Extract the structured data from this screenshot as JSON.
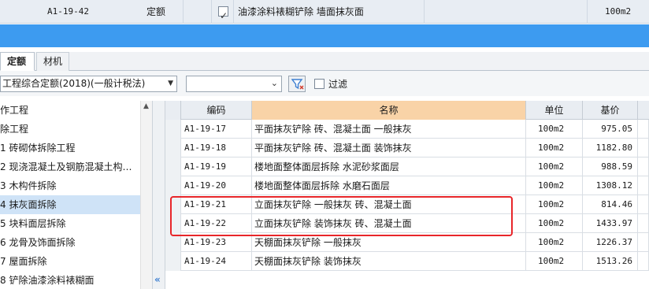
{
  "top_row": {
    "code": "A1-19-42",
    "type": "定额",
    "checked": true,
    "name": "油漆涂料裱糊铲除 墙面抹灰面",
    "unit": "100m2"
  },
  "tabs": [
    {
      "label": "定额",
      "active": true
    },
    {
      "label": "材机",
      "active": false
    }
  ],
  "toolbar": {
    "quota_select": "工程综合定额(2018)(一般计税法)",
    "search_select": "",
    "filter_label": "过滤"
  },
  "tree": {
    "items": [
      {
        "label": "作工程",
        "selected": false
      },
      {
        "label": "除工程",
        "selected": false
      },
      {
        "label": "1 砖砌体拆除工程",
        "selected": false
      },
      {
        "label": "2 现浇混凝土及钢筋混凝土构…",
        "selected": false
      },
      {
        "label": "3 木构件拆除",
        "selected": false
      },
      {
        "label": "4 抹灰面拆除",
        "selected": true
      },
      {
        "label": "5 块料面层拆除",
        "selected": false
      },
      {
        "label": "6 龙骨及饰面拆除",
        "selected": false
      },
      {
        "label": "7 屋面拆除",
        "selected": false
      },
      {
        "label": "8 铲除油漆涂料裱糊面",
        "selected": false
      }
    ]
  },
  "grid": {
    "headers": {
      "code": "编码",
      "name": "名称",
      "unit": "单位",
      "price": "基价"
    },
    "rows": [
      {
        "code": "A1-19-17",
        "name": "平面抹灰铲除 砖、混凝土面 一般抹灰",
        "unit": "100m2",
        "price": "975.05"
      },
      {
        "code": "A1-19-18",
        "name": "平面抹灰铲除 砖、混凝土面 装饰抹灰",
        "unit": "100m2",
        "price": "1182.80"
      },
      {
        "code": "A1-19-19",
        "name": "楼地面整体面层拆除 水泥砂浆面层",
        "unit": "100m2",
        "price": "988.59"
      },
      {
        "code": "A1-19-20",
        "name": "楼地面整体面层拆除 水磨石面层",
        "unit": "100m2",
        "price": "1308.12"
      },
      {
        "code": "A1-19-21",
        "name": "立面抹灰铲除 一般抹灰 砖、混凝土面",
        "unit": "100m2",
        "price": "814.46"
      },
      {
        "code": "A1-19-22",
        "name": "立面抹灰铲除 装饰抹灰 砖、混凝土面",
        "unit": "100m2",
        "price": "1433.97"
      },
      {
        "code": "A1-19-23",
        "name": "天棚面抹灰铲除 一般抹灰",
        "unit": "100m2",
        "price": "1226.37"
      },
      {
        "code": "A1-19-24",
        "name": "天棚面抹灰铲除 装饰抹灰",
        "unit": "100m2",
        "price": "1513.26"
      }
    ]
  },
  "colors": {
    "band_blue": "#3d9bf0",
    "name_header": "#f9d3a7",
    "highlight_red": "#e8262a",
    "tree_selected": "#cfe3f7"
  }
}
